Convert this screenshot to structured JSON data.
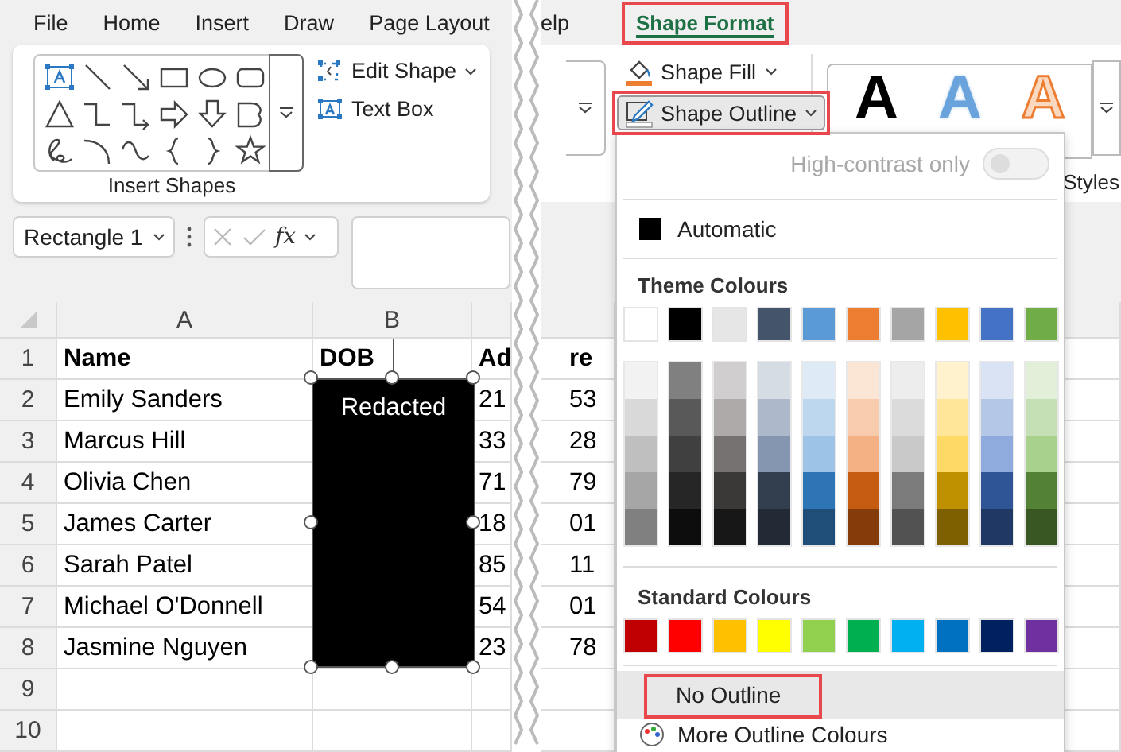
{
  "left_pane": {
    "tabs": [
      {
        "label": "File",
        "selected": false
      },
      {
        "label": "Home",
        "selected": false
      },
      {
        "label": "Insert",
        "selected": false
      },
      {
        "label": "Draw",
        "selected": false
      },
      {
        "label": "Page Layout",
        "selected": false
      }
    ],
    "insert_shapes": {
      "label": "Insert Shapes",
      "commands": [
        {
          "label": "Edit Shape",
          "dropdown": true
        },
        {
          "label": "Text Box",
          "dropdown": false
        }
      ]
    },
    "name_box": {
      "value": "Rectangle 1"
    },
    "formula_bar": {
      "function_label": "fx"
    },
    "sheet": {
      "columns": [
        "A",
        "B"
      ],
      "rows": [
        {
          "number": "1",
          "header": true,
          "name": "Name",
          "dob": "DOB",
          "column_3": "Ad"
        },
        {
          "number": "2",
          "header": false,
          "name": "Emily Sanders",
          "column_3": "21"
        },
        {
          "number": "3",
          "header": false,
          "name": "Marcus Hill",
          "column_3": "33"
        },
        {
          "number": "4",
          "header": false,
          "name": "Olivia Chen",
          "column_3": "71"
        },
        {
          "number": "5",
          "header": false,
          "name": "James Carter",
          "column_3": "18"
        },
        {
          "number": "6",
          "header": false,
          "name": "Sarah Patel",
          "column_3": "85"
        },
        {
          "number": "7",
          "header": false,
          "name": "Michael O'Donnell",
          "column_3": "54"
        },
        {
          "number": "8",
          "header": false,
          "name": "Jasmine Nguyen",
          "column_3": "23"
        },
        {
          "number": "9"
        },
        {
          "number": "10"
        }
      ]
    },
    "shape": {
      "text": "Redacted",
      "selected": true
    }
  },
  "right_pane": {
    "tabs": [
      {
        "label": "elp",
        "selected": false,
        "highlighted": false
      },
      {
        "label": "Shape Format",
        "selected": true,
        "highlighted": true
      }
    ],
    "commands": [
      {
        "label": "Shape Fill",
        "kind": "fill",
        "dropdown": true,
        "pressed": false,
        "highlighted": false
      },
      {
        "label": "Shape Outline",
        "kind": "outline",
        "dropdown": true,
        "pressed": true,
        "highlighted": true
      }
    ],
    "wordart_styles": {
      "label": "Styles",
      "items": [
        {
          "label": "A",
          "kind": "solid"
        },
        {
          "label": "A",
          "kind": "gradient"
        },
        {
          "label": "A",
          "kind": "outline"
        }
      ]
    },
    "column_3_cells": [
      {
        "text": "re",
        "header": true
      },
      {
        "text": "53",
        "header": false
      },
      {
        "text": "28",
        "header": false
      },
      {
        "text": "79",
        "header": false
      },
      {
        "text": "01",
        "header": false
      },
      {
        "text": "11",
        "header": false
      },
      {
        "text": "01",
        "header": false
      },
      {
        "text": "78",
        "header": false
      }
    ],
    "outline_menu": {
      "high_contrast": {
        "label": "High-contrast only",
        "on": false,
        "disabled": true
      },
      "automatic": {
        "label": "Automatic",
        "color": "#000000"
      },
      "theme_heading": "Theme Colours",
      "theme_colors": [
        {
          "color": "#ffffff"
        },
        {
          "color": "#000000"
        },
        {
          "color": "#e7e6e6"
        },
        {
          "color": "#44546a"
        },
        {
          "color": "#5b9bd5"
        },
        {
          "color": "#ed7d31"
        },
        {
          "color": "#a5a5a5"
        },
        {
          "color": "#ffc000"
        },
        {
          "color": "#4472c4"
        },
        {
          "color": "#70ad47"
        }
      ],
      "theme_tints": [
        {
          "shades": [
            {
              "color": "#f2f2f2"
            },
            {
              "color": "#d9d9d9"
            },
            {
              "color": "#bfbfbf"
            },
            {
              "color": "#a6a6a6"
            },
            {
              "color": "#808080"
            }
          ]
        },
        {
          "shades": [
            {
              "color": "#808080"
            },
            {
              "color": "#595959"
            },
            {
              "color": "#404040"
            },
            {
              "color": "#262626"
            },
            {
              "color": "#0d0d0d"
            }
          ]
        },
        {
          "shades": [
            {
              "color": "#d0cece"
            },
            {
              "color": "#aeaaaa"
            },
            {
              "color": "#757171"
            },
            {
              "color": "#3b3838"
            },
            {
              "color": "#181717"
            }
          ]
        },
        {
          "shades": [
            {
              "color": "#d6dce4"
            },
            {
              "color": "#adb9ca"
            },
            {
              "color": "#8496b0"
            },
            {
              "color": "#333f4f"
            },
            {
              "color": "#222a35"
            }
          ]
        },
        {
          "shades": [
            {
              "color": "#deebf6"
            },
            {
              "color": "#bdd7ee"
            },
            {
              "color": "#9dc3e6"
            },
            {
              "color": "#2e75b5"
            },
            {
              "color": "#1f4e79"
            }
          ]
        },
        {
          "shades": [
            {
              "color": "#fbe5d5"
            },
            {
              "color": "#f8cbad"
            },
            {
              "color": "#f4b183"
            },
            {
              "color": "#c55a11"
            },
            {
              "color": "#843c0b"
            }
          ]
        },
        {
          "shades": [
            {
              "color": "#ededed"
            },
            {
              "color": "#dbdbdb"
            },
            {
              "color": "#c9c9c9"
            },
            {
              "color": "#7b7b7b"
            },
            {
              "color": "#525252"
            }
          ]
        },
        {
          "shades": [
            {
              "color": "#fff2cc"
            },
            {
              "color": "#ffe699"
            },
            {
              "color": "#ffd966"
            },
            {
              "color": "#bf9000"
            },
            {
              "color": "#7f6000"
            }
          ]
        },
        {
          "shades": [
            {
              "color": "#dae3f3"
            },
            {
              "color": "#b4c7e7"
            },
            {
              "color": "#8faadc"
            },
            {
              "color": "#2f5597"
            },
            {
              "color": "#1f3864"
            }
          ]
        },
        {
          "shades": [
            {
              "color": "#e2f0d9"
            },
            {
              "color": "#c5e0b4"
            },
            {
              "color": "#a9d18e"
            },
            {
              "color": "#538135"
            },
            {
              "color": "#385723"
            }
          ]
        }
      ],
      "standard_heading": "Standard Colours",
      "standard_colors": [
        {
          "color": "#c00000"
        },
        {
          "color": "#ff0000"
        },
        {
          "color": "#ffc000"
        },
        {
          "color": "#ffff00"
        },
        {
          "color": "#92d050"
        },
        {
          "color": "#00b050"
        },
        {
          "color": "#00b0f0"
        },
        {
          "color": "#0070c0"
        },
        {
          "color": "#002060"
        },
        {
          "color": "#7030a0"
        }
      ],
      "items": [
        {
          "label": "No Outline",
          "kind": "plain",
          "hovered": true,
          "highlighted": true
        },
        {
          "label": "More Outline Colours",
          "kind": "palette",
          "hovered": false,
          "highlighted": false
        }
      ]
    }
  }
}
